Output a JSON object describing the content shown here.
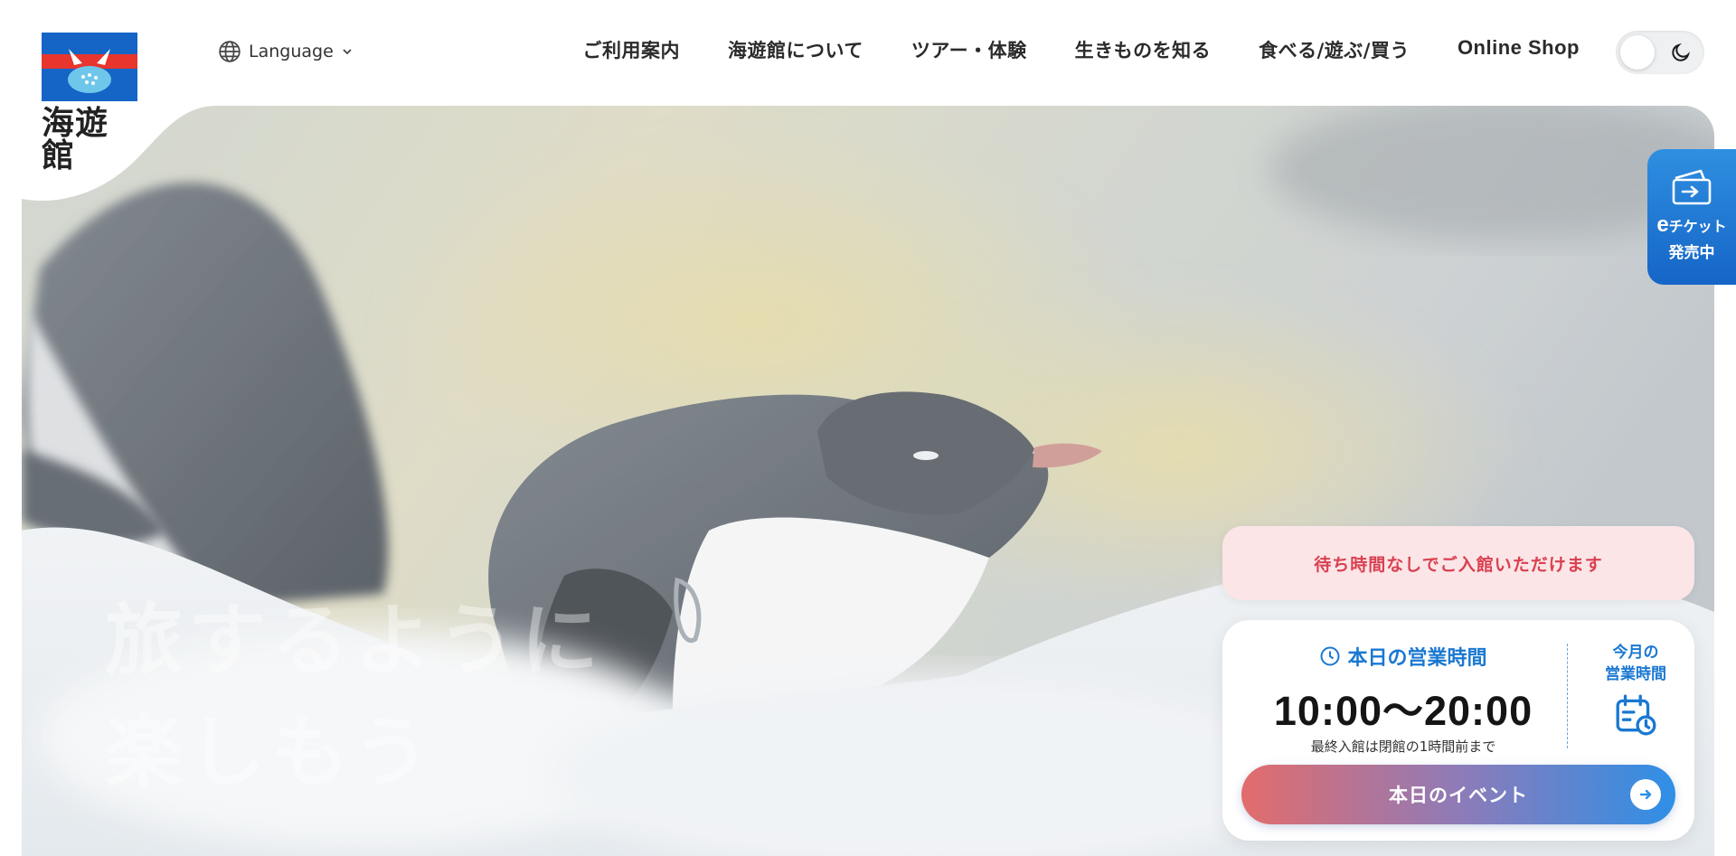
{
  "brand": {
    "name": "海遊館",
    "colors": {
      "blue": "#1565c7",
      "red": "#e8352e",
      "accent": "#1a78d1"
    }
  },
  "header": {
    "language_label": "Language",
    "nav": [
      {
        "label": "ご利用案内"
      },
      {
        "label": "海遊館について"
      },
      {
        "label": "ツアー・体験"
      },
      {
        "label": "生きものを知る"
      },
      {
        "label": "食べる/遊ぶ/買う"
      },
      {
        "label": "Online Shop"
      }
    ],
    "theme_toggle": {
      "mode": "light",
      "icon": "moon-icon"
    }
  },
  "hero": {
    "image": "penguin-on-snow",
    "tagline": [
      "旅するように",
      "楽しもう"
    ]
  },
  "eticket": {
    "prefix": "e",
    "label": "チケット",
    "status": "発売中"
  },
  "notice": {
    "text": "待ち時間なしでご入館いただけます"
  },
  "hours": {
    "title": "本日の営業時間",
    "time": "10:00～20:00",
    "note": "最終入館は閉館の1時間前まで",
    "monthly_label": "今月の\n営業時間"
  },
  "event_button": {
    "label": "本日のイベント"
  }
}
